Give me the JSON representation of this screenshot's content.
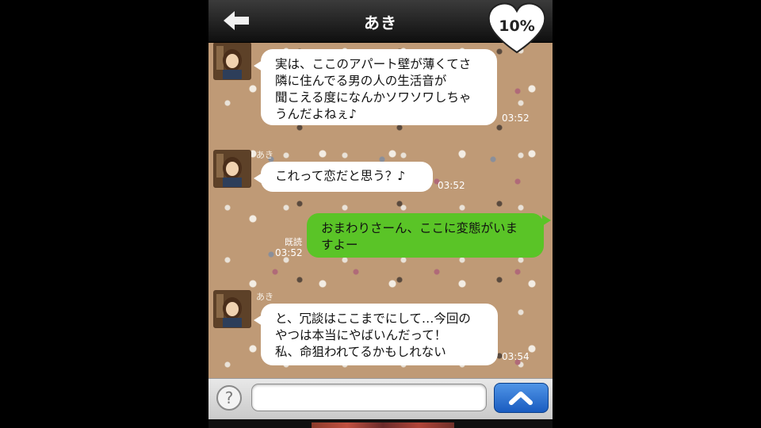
{
  "header": {
    "title": "あき",
    "affection_badge": "10%"
  },
  "messages": [
    {
      "sender": "",
      "text": "実は、ここのアパート壁が薄くてさ\n隣に住んでる男の人の生活音が\n聞こえる度になんかソワソワしちゃ\nうんだよねぇ♪",
      "time": "03:52"
    },
    {
      "sender": "あき",
      "text": "これって恋だと思う？♪",
      "time": "03:52"
    },
    {
      "read_label": "既読",
      "text": "おまわりさーん、ここに変態がいま\nすよー",
      "time": "03:52"
    },
    {
      "sender": "あき",
      "text": "と、冗談はここまでにして…今回の\nやつは本当にやばいんだって！\n私、命狙われてるかもしれない",
      "time": "03:54"
    }
  ],
  "input_bar": {
    "help_label": "?",
    "message_value": ""
  },
  "colors": {
    "sent_bubble": "#5ac427",
    "send_button": "#2a6fd0",
    "chat_background": "#bf9a76"
  },
  "icons": [
    "back-arrow-icon",
    "heart-icon",
    "help-icon",
    "chevron-up-icon"
  ]
}
